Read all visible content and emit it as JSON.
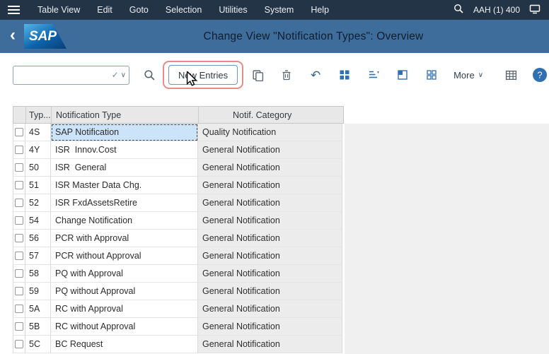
{
  "menubar": {
    "items": [
      "Table View",
      "Edit",
      "Goto",
      "Selection",
      "Utilities",
      "System",
      "Help"
    ],
    "session_label": "AAH (1) 400"
  },
  "titlebar": {
    "back_glyph": "‹",
    "logo_text": "SAP",
    "title": "Change View \"Notification Types\": Overview"
  },
  "toolbar": {
    "command_field": {
      "value": "",
      "check_glyph": "✓",
      "dropdown_glyph": "∨"
    },
    "new_entries_label": "New Entries",
    "more_label": "More",
    "more_chevron": "∨",
    "icons": [
      "search-icon",
      "copy-entries-icon",
      "delete-icon",
      "undo-icon",
      "select-all-icon",
      "sort-ascending-icon",
      "select-block-icon",
      "deselect-all-icon",
      "grid-view-icon",
      "help-icon"
    ]
  },
  "table": {
    "headers": {
      "typ": "Typ...",
      "notification_type": "Notification Type",
      "notif_category": "Notif. Category"
    },
    "rows": [
      {
        "typ": "4S",
        "notification_type": "SAP Notification",
        "notif_category": "Quality Notification",
        "selected": true
      },
      {
        "typ": "4Y",
        "notification_type": "ISR  Innov.Cost",
        "notif_category": "General Notification"
      },
      {
        "typ": "50",
        "notification_type": "ISR  General",
        "notif_category": "General Notification"
      },
      {
        "typ": "51",
        "notification_type": "ISR Master Data Chg.",
        "notif_category": "General Notification"
      },
      {
        "typ": "52",
        "notification_type": "ISR FxdAssetsRetire",
        "notif_category": "General Notification"
      },
      {
        "typ": "54",
        "notification_type": "Change Notification",
        "notif_category": "General Notification"
      },
      {
        "typ": "56",
        "notification_type": "PCR with Approval",
        "notif_category": "General Notification"
      },
      {
        "typ": "57",
        "notification_type": "PCR without Approval",
        "notif_category": "General Notification"
      },
      {
        "typ": "58",
        "notification_type": "PQ with Approval",
        "notif_category": "General Notification"
      },
      {
        "typ": "59",
        "notification_type": "PQ without Approval",
        "notif_category": "General Notification"
      },
      {
        "typ": "5A",
        "notification_type": "RC with Approval",
        "notif_category": "General Notification"
      },
      {
        "typ": "5B",
        "notification_type": "RC without Approval",
        "notif_category": "General Notification"
      },
      {
        "typ": "5C",
        "notification_type": "BC Request",
        "notif_category": "General Notification"
      }
    ]
  },
  "colors": {
    "menubar_bg": "#243447",
    "titlebar_bg": "#3e6d9c",
    "highlight_ring": "#ea8c84",
    "selected_cell": "#cbe4f9",
    "icon_blue": "#2f6fb2"
  }
}
